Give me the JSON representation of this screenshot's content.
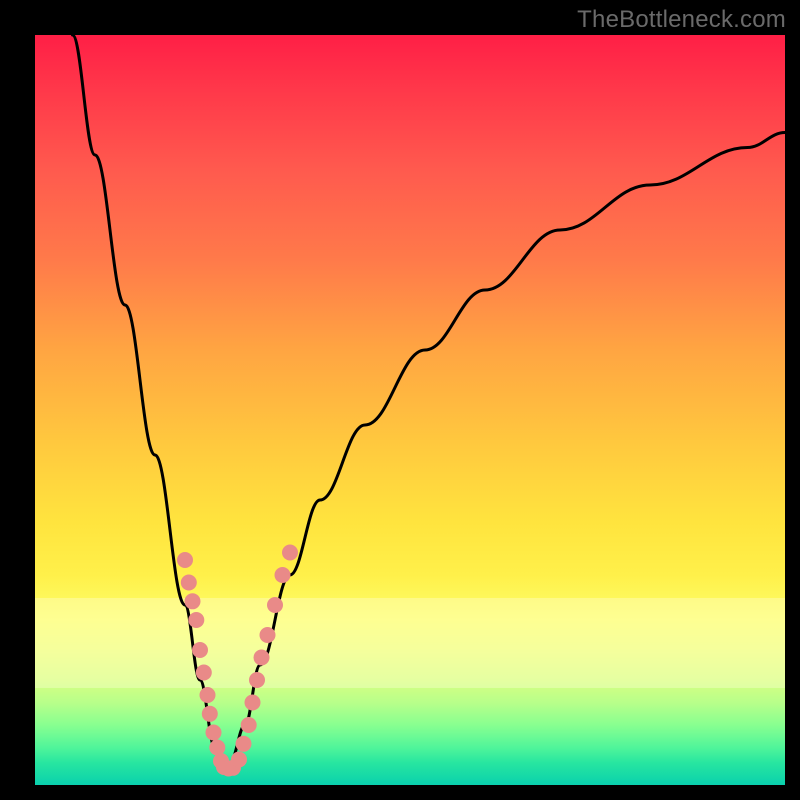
{
  "watermark": "TheBottleneck.com",
  "colors": {
    "frame": "#000000",
    "curve": "#000000",
    "dot_fill": "#e98a88",
    "dot_stroke": "#e98a88"
  },
  "chart_data": {
    "type": "line",
    "title": "",
    "xlabel": "",
    "ylabel": "",
    "xlim": [
      0,
      100
    ],
    "ylim": [
      0,
      100
    ],
    "note": "y-axis represents bottleneck percentage; colors map to quality: green≈good near bottom, red≈bad near top. Curve is V-shaped with minimum near x≈25.",
    "series": [
      {
        "name": "bottleneck-curve",
        "x": [
          5,
          8,
          12,
          16,
          20,
          22,
          24,
          25,
          26,
          28,
          30,
          34,
          38,
          44,
          52,
          60,
          70,
          82,
          95,
          100
        ],
        "y": [
          100,
          84,
          64,
          44,
          24,
          14,
          5,
          2,
          3,
          8,
          16,
          28,
          38,
          48,
          58,
          66,
          74,
          80,
          85,
          87
        ]
      }
    ],
    "dots": [
      {
        "x": 20.0,
        "y": 30.0
      },
      {
        "x": 20.5,
        "y": 27.0
      },
      {
        "x": 21.0,
        "y": 24.5
      },
      {
        "x": 21.5,
        "y": 22.0
      },
      {
        "x": 22.0,
        "y": 18.0
      },
      {
        "x": 22.5,
        "y": 15.0
      },
      {
        "x": 23.0,
        "y": 12.0
      },
      {
        "x": 23.3,
        "y": 9.5
      },
      {
        "x": 23.8,
        "y": 7.0
      },
      {
        "x": 24.3,
        "y": 5.0
      },
      {
        "x": 24.8,
        "y": 3.2
      },
      {
        "x": 25.2,
        "y": 2.4
      },
      {
        "x": 25.8,
        "y": 2.2
      },
      {
        "x": 26.4,
        "y": 2.3
      },
      {
        "x": 27.2,
        "y": 3.4
      },
      {
        "x": 27.8,
        "y": 5.5
      },
      {
        "x": 28.5,
        "y": 8.0
      },
      {
        "x": 29.0,
        "y": 11.0
      },
      {
        "x": 29.6,
        "y": 14.0
      },
      {
        "x": 30.2,
        "y": 17.0
      },
      {
        "x": 31.0,
        "y": 20.0
      },
      {
        "x": 32.0,
        "y": 24.0
      },
      {
        "x": 33.0,
        "y": 28.0
      },
      {
        "x": 34.0,
        "y": 31.0
      }
    ]
  }
}
